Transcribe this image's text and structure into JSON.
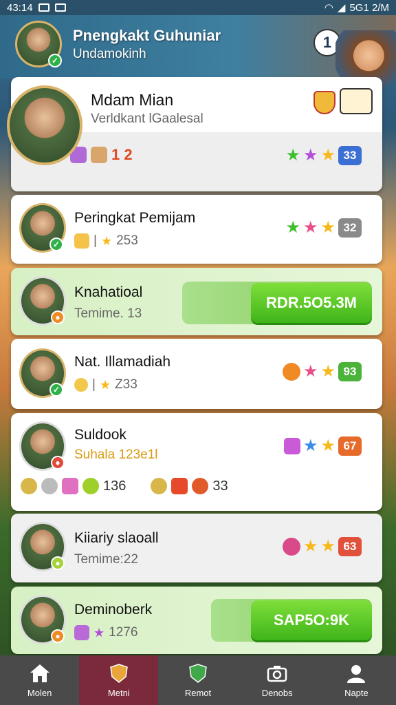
{
  "status": {
    "time": "43:14",
    "right_text": "5G1 2/M"
  },
  "header": {
    "title": "Pnengkakt Guhuniar",
    "subtitle": "Undamokinh",
    "help_label": "1"
  },
  "cards": [
    {
      "name": "Mdam Mian",
      "sub": "Verldkant lGaalesal",
      "items_text": "1 2",
      "score": "33"
    },
    {
      "name": "Peringkat Pemijam",
      "sub": "253",
      "score": "32"
    },
    {
      "name": "Knahatioal",
      "sub": "Temime. 13",
      "button": "RDR.5O5.3M"
    },
    {
      "name": "Nat. Illamadiah",
      "sub": "Z33",
      "score": "93"
    },
    {
      "name": "Suldook",
      "sub": "Suhala 123e1l",
      "items_a": "136",
      "items_b": "33",
      "score": "67"
    },
    {
      "name": "Kiiariy slaoall",
      "sub": "Temime:22",
      "score": "63"
    },
    {
      "name": "Deminoberk",
      "sub": "1276",
      "button": "SAP5O:9K"
    }
  ],
  "tabs": [
    {
      "label": "Molen"
    },
    {
      "label": "Metni",
      "active": true
    },
    {
      "label": "Remot"
    },
    {
      "label": "Denobs"
    },
    {
      "label": "Napte"
    }
  ],
  "colors": {
    "accent": "#3fb41a",
    "tab_active": "#7a2a3a"
  }
}
